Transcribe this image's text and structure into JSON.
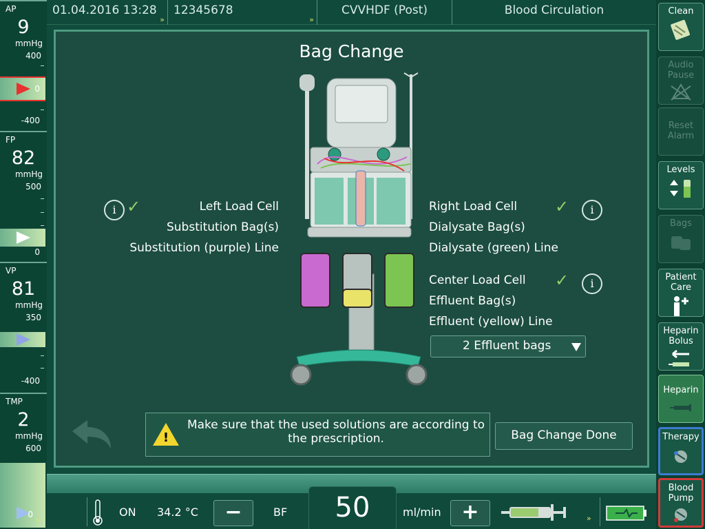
{
  "header": {
    "datetime": "01.04.2016 13:28",
    "patient_id": "12345678",
    "therapy_mode": "CVVHDF (Post)",
    "screen": "Blood Circulation",
    "more_arrows": "»"
  },
  "pressures": [
    {
      "label": "AP",
      "value": "9",
      "unit": "mmHg",
      "max": "400",
      "zero": "0",
      "min": "-400",
      "marker_color": "#e8322f"
    },
    {
      "label": "FP",
      "value": "82",
      "unit": "mmHg",
      "max": "500",
      "zero": "0",
      "marker_color": "#ffffff"
    },
    {
      "label": "VP",
      "value": "81",
      "unit": "mmHg",
      "max": "350",
      "zero": "0",
      "min": "-400",
      "marker_color": "#8fa3e6"
    },
    {
      "label": "TMP",
      "value": "2",
      "unit": "mmHg",
      "max": "600",
      "zero": "0",
      "marker_color": "#9ec0f0"
    }
  ],
  "right_buttons": [
    {
      "label": "Clean",
      "icon": "clean-icon",
      "enabled": true
    },
    {
      "label": "Audio Pause",
      "icon": "audio-pause-icon",
      "enabled": false
    },
    {
      "label": "Reset Alarm",
      "icon": "",
      "enabled": false
    },
    {
      "label": "Levels",
      "icon": "levels-icon",
      "enabled": true
    },
    {
      "label": "Bags",
      "icon": "bags-icon",
      "enabled": false
    },
    {
      "label": "Patient Care",
      "icon": "patient-care-icon",
      "enabled": true
    },
    {
      "label": "Heparin Bolus",
      "icon": "heparin-bolus-icon",
      "enabled": true
    },
    {
      "label": "Heparin",
      "icon": "syringe-icon",
      "enabled": true
    },
    {
      "label": "Therapy",
      "icon": "therapy-icon",
      "enabled": true
    },
    {
      "label": "Blood Pump",
      "icon": "blood-pump-icon",
      "enabled": true
    }
  ],
  "dialog": {
    "title": "Bag Change",
    "left": {
      "line1": "Left Load Cell",
      "line2": "Substitution Bag(s)",
      "line3": "Substitution (purple) Line",
      "checked": true
    },
    "right": {
      "line1": "Right Load Cell",
      "line2": "Dialysate Bag(s)",
      "line3": "Dialysate (green) Line",
      "checked": true
    },
    "center": {
      "line1": "Center Load Cell",
      "line2": "Effluent Bag(s)",
      "line3": "Effluent (yellow) Line",
      "checked": true
    },
    "effluent_select": "2 Effluent bags",
    "info_glyph": "i",
    "check_glyph": "✓",
    "warning": "Make sure that the used solutions are according to the prescription.",
    "warning_glyph": "!",
    "done_label": "Bag Change Done",
    "bag_colors": {
      "purple": "#c96ad0",
      "effluent": "#e9e36a",
      "green": "#7cc552"
    }
  },
  "bottom": {
    "heater_state": "ON",
    "temperature": "34.2 °C",
    "minus": "−",
    "bf_label": "BF",
    "blood_flow": "50",
    "flow_unit": "ml/min",
    "plus": "+"
  },
  "colors": {
    "background": "#0e4637",
    "dialog": "#1c4d40",
    "accent_teal": "#3a9b82",
    "warning": "#f2d62e"
  }
}
